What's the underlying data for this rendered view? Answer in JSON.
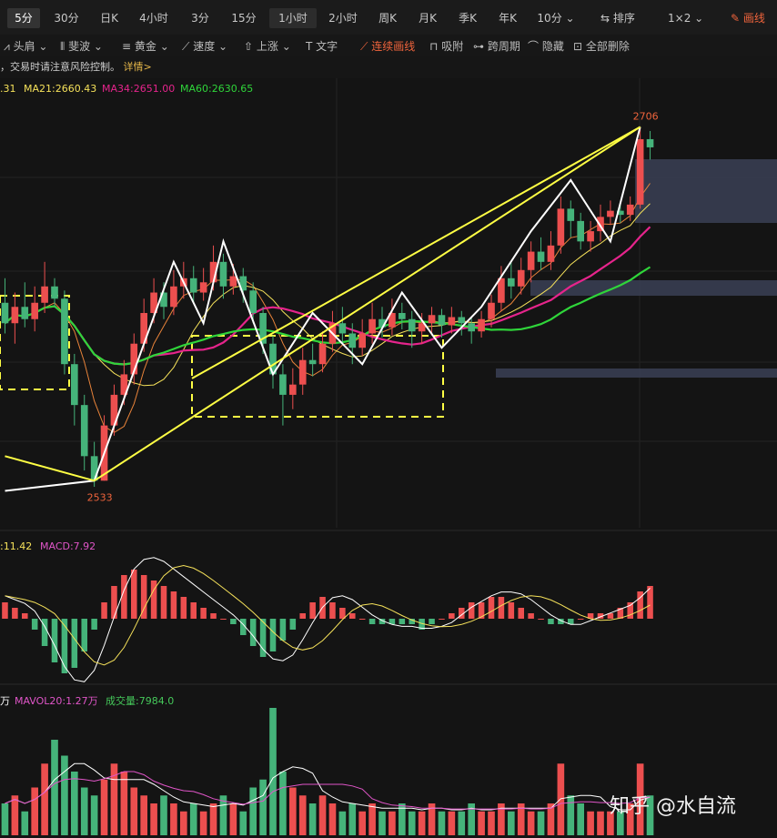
{
  "tabs": [
    {
      "label": "5分",
      "active": true
    },
    {
      "label": "30分"
    },
    {
      "label": "日K"
    },
    {
      "label": "4小时"
    },
    {
      "label": "3分"
    },
    {
      "label": "15分"
    },
    {
      "label": "1小时",
      "active_box": true
    },
    {
      "label": "2小时"
    },
    {
      "label": "周K"
    },
    {
      "label": "月K"
    },
    {
      "label": "季K"
    },
    {
      "label": "年K"
    },
    {
      "label": "10分 ⌄"
    }
  ],
  "right_controls": {
    "sort": "排序",
    "layout": "1×2 ⌄",
    "draw": "画线"
  },
  "toolbar": {
    "items": [
      "头肩 ⌄",
      "斐波 ⌄",
      "黄金 ⌄",
      "速度 ⌄",
      "上涨 ⌄",
      "文字"
    ],
    "continuous": "连续画线",
    "snap": "吸附",
    "cross_period": "跨周期",
    "hide": "隐藏",
    "delete_all": "全部删除"
  },
  "notice": {
    "text": "，交易时请注意风险控制。",
    "link": "详情>"
  },
  "ma": {
    "ma_partial": ".31",
    "ma21": "MA21:2660.43",
    "ma34": "MA34:2651.00",
    "ma60": "MA60:2630.65"
  },
  "macd": {
    "dea": ":11.42",
    "macd": "MACD:7.92"
  },
  "vol": {
    "unit": "万",
    "mavol20": "MAVOL20:1.27万",
    "volume": "成交量:7984.0"
  },
  "watermark": "知乎 @水自流",
  "colors": {
    "up": "#ec4f4f",
    "down": "#45b37a",
    "ma_white": "#ffffff",
    "ma_yellow": "#f5e15a",
    "ma_magenta": "#e6248c",
    "ma_green": "#2fd53a",
    "annotation": "#ffff44"
  },
  "chart_data": {
    "type": "candlestick",
    "annotations": {
      "high": "2706",
      "low": "2533"
    },
    "price_range": [
      2510,
      2720
    ],
    "candles": [
      [
        2620,
        2610,
        2632,
        2605
      ],
      [
        2610,
        2618,
        2625,
        2600
      ],
      [
        2618,
        2612,
        2630,
        2608
      ],
      [
        2612,
        2620,
        2628,
        2606
      ],
      [
        2620,
        2628,
        2640,
        2615
      ],
      [
        2628,
        2622,
        2632,
        2618
      ],
      [
        2622,
        2590,
        2626,
        2585
      ],
      [
        2590,
        2570,
        2595,
        2560
      ],
      [
        2570,
        2545,
        2575,
        2538
      ],
      [
        2545,
        2533,
        2552,
        2530
      ],
      [
        2533,
        2560,
        2565,
        2533
      ],
      [
        2560,
        2575,
        2580,
        2555
      ],
      [
        2575,
        2585,
        2592,
        2570
      ],
      [
        2585,
        2600,
        2605,
        2580
      ],
      [
        2600,
        2615,
        2622,
        2596
      ],
      [
        2615,
        2625,
        2632,
        2610
      ],
      [
        2625,
        2618,
        2630,
        2612
      ],
      [
        2618,
        2628,
        2636,
        2614
      ],
      [
        2628,
        2632,
        2640,
        2622
      ],
      [
        2632,
        2625,
        2638,
        2620
      ],
      [
        2625,
        2630,
        2637,
        2621
      ],
      [
        2630,
        2640,
        2648,
        2626
      ],
      [
        2640,
        2628,
        2644,
        2622
      ],
      [
        2628,
        2633,
        2639,
        2624
      ],
      [
        2633,
        2626,
        2637,
        2620
      ],
      [
        2626,
        2615,
        2630,
        2610
      ],
      [
        2615,
        2600,
        2618,
        2595
      ],
      [
        2600,
        2585,
        2604,
        2578
      ],
      [
        2585,
        2575,
        2590,
        2560
      ],
      [
        2575,
        2580,
        2588,
        2568
      ],
      [
        2580,
        2592,
        2598,
        2575
      ],
      [
        2592,
        2590,
        2600,
        2584
      ],
      [
        2590,
        2600,
        2606,
        2586
      ],
      [
        2600,
        2610,
        2616,
        2596
      ],
      [
        2610,
        2605,
        2618,
        2600
      ],
      [
        2605,
        2598,
        2610,
        2590
      ],
      [
        2598,
        2605,
        2612,
        2594
      ],
      [
        2605,
        2612,
        2620,
        2600
      ],
      [
        2612,
        2608,
        2618,
        2603
      ],
      [
        2608,
        2615,
        2622,
        2604
      ],
      [
        2615,
        2612,
        2620,
        2607
      ],
      [
        2612,
        2606,
        2616,
        2598
      ],
      [
        2606,
        2610,
        2615,
        2600
      ],
      [
        2610,
        2614,
        2618,
        2604
      ],
      [
        2614,
        2609,
        2617,
        2603
      ],
      [
        2609,
        2613,
        2618,
        2605
      ],
      [
        2613,
        2610,
        2616,
        2604
      ],
      [
        2610,
        2606,
        2613,
        2600
      ],
      [
        2606,
        2612,
        2616,
        2603
      ],
      [
        2612,
        2620,
        2624,
        2608
      ],
      [
        2620,
        2632,
        2638,
        2616
      ],
      [
        2632,
        2628,
        2640,
        2622
      ],
      [
        2628,
        2636,
        2642,
        2624
      ],
      [
        2636,
        2645,
        2650,
        2630
      ],
      [
        2645,
        2640,
        2652,
        2636
      ],
      [
        2640,
        2648,
        2655,
        2636
      ],
      [
        2648,
        2666,
        2672,
        2644
      ],
      [
        2666,
        2660,
        2670,
        2652
      ],
      [
        2660,
        2650,
        2664,
        2646
      ],
      [
        2650,
        2655,
        2660,
        2645
      ],
      [
        2655,
        2662,
        2668,
        2650
      ],
      [
        2662,
        2665,
        2670,
        2658
      ],
      [
        2665,
        2663,
        2669,
        2659
      ],
      [
        2663,
        2668,
        2672,
        2660
      ],
      [
        2668,
        2700,
        2706,
        2666
      ],
      [
        2700,
        2696,
        2704,
        2690
      ]
    ],
    "macd_hist": [
      3,
      2,
      1,
      -2,
      -5,
      -8,
      -10,
      -9,
      -6,
      -2,
      3,
      6,
      8,
      9,
      8,
      7,
      6,
      5,
      4,
      3,
      2,
      1,
      0,
      -1,
      -3,
      -5,
      -7,
      -6,
      -4,
      -2,
      1,
      3,
      4,
      3,
      2,
      1,
      0,
      -1,
      -1,
      -1,
      -1,
      -1,
      -2,
      -1,
      0,
      1,
      2,
      3,
      3,
      4,
      4,
      3,
      2,
      1,
      0,
      -1,
      -1,
      -1,
      0,
      1,
      1,
      1,
      2,
      3,
      5,
      6
    ],
    "volume": [
      4,
      5,
      3,
      6,
      9,
      12,
      10,
      8,
      6,
      5,
      7,
      9,
      8,
      6,
      5,
      4,
      5,
      4,
      3,
      4,
      3,
      4,
      5,
      4,
      3,
      6,
      7,
      16,
      8,
      6,
      5,
      4,
      5,
      4,
      3,
      4,
      3,
      4,
      3,
      3,
      4,
      3,
      3,
      4,
      3,
      3,
      3,
      4,
      3,
      3,
      4,
      3,
      4,
      3,
      3,
      4,
      9,
      5,
      4,
      3,
      3,
      3,
      3,
      4,
      9,
      5
    ]
  }
}
